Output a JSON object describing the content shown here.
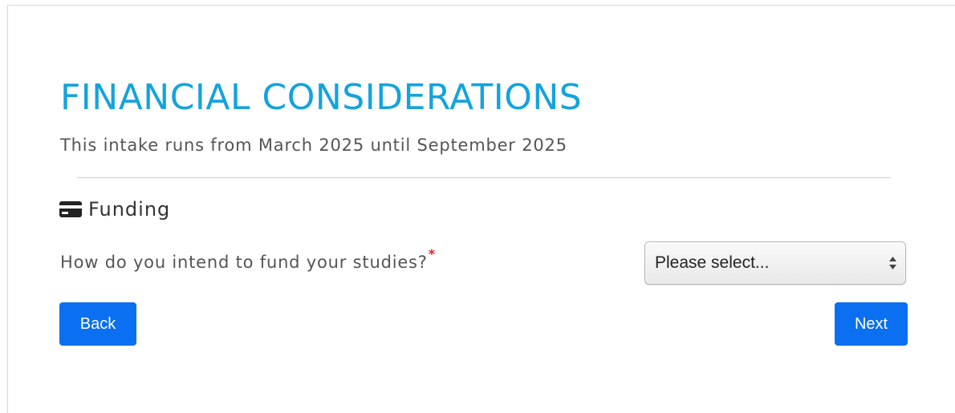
{
  "page": {
    "title": "FINANCIAL CONSIDERATIONS",
    "intake_text": "This intake runs from March 2025 until September 2025"
  },
  "section": {
    "icon": "credit-card-icon",
    "label": "Funding"
  },
  "question": {
    "label": "How do you intend to fund your studies?",
    "required_marker": "*",
    "select": {
      "selected_value": "Please select..."
    }
  },
  "buttons": {
    "back_label": "Back",
    "next_label": "Next"
  },
  "colors": {
    "title": "#14a3dd",
    "button": "#0a6ff0",
    "required": "#e0201b"
  }
}
